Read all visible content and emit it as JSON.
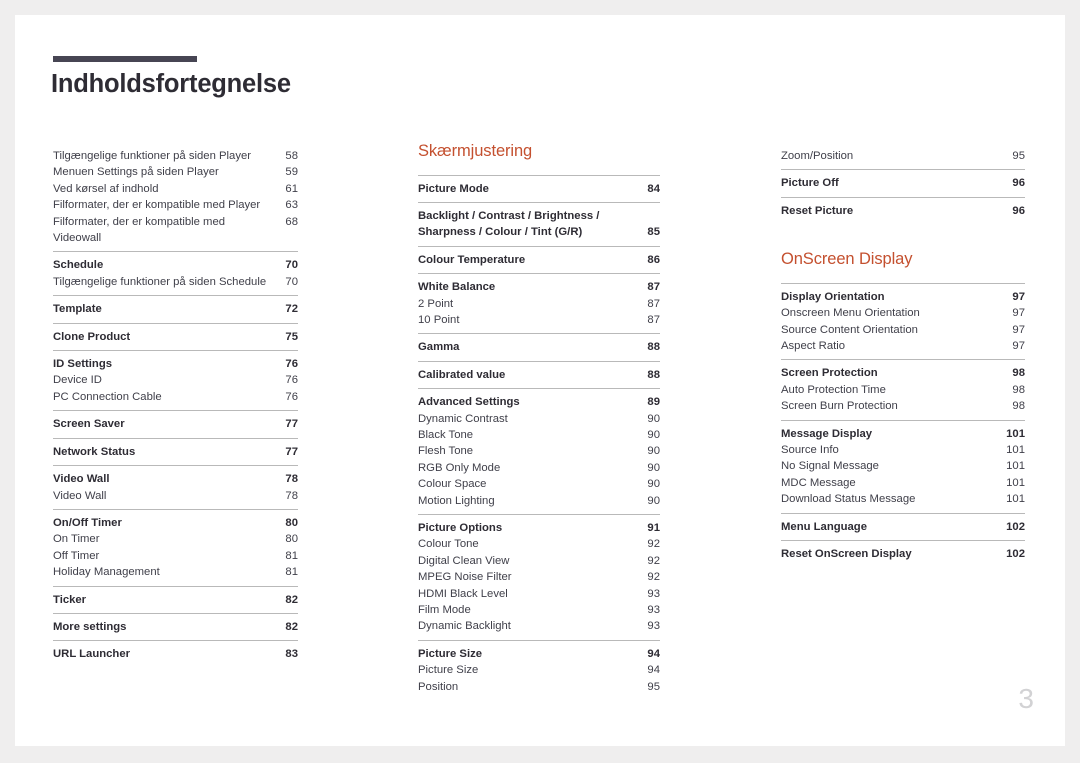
{
  "document": {
    "title": "Indholdsfortegnelse",
    "page_number": "3",
    "accent_color": "#c4502f",
    "rule_color": "#474553"
  },
  "columns": [
    {
      "id": "column-left",
      "heading": null,
      "groups": [
        {
          "rule": false,
          "rows": [
            {
              "level": 2,
              "label": "Tilgængelige funktioner på siden Player",
              "page": "58"
            },
            {
              "level": 2,
              "label": "Menuen Settings på siden Player",
              "page": "59"
            },
            {
              "level": 2,
              "label": "Ved kørsel af indhold",
              "page": "61"
            },
            {
              "level": 2,
              "label": "Filformater, der er kompatible med Player",
              "page": "63"
            },
            {
              "level": 2,
              "label": "Filformater, der er kompatible med Videowall",
              "page": "68"
            }
          ]
        },
        {
          "rule": true,
          "rows": [
            {
              "level": 1,
              "label": "Schedule",
              "page": "70"
            },
            {
              "level": 2,
              "label": "Tilgængelige funktioner på siden Schedule",
              "page": "70"
            }
          ]
        },
        {
          "rule": true,
          "rows": [
            {
              "level": 1,
              "label": "Template",
              "page": "72"
            }
          ]
        },
        {
          "rule": true,
          "rows": [
            {
              "level": 1,
              "label": "Clone Product",
              "page": "75"
            }
          ]
        },
        {
          "rule": true,
          "rows": [
            {
              "level": 1,
              "label": "ID Settings",
              "page": "76"
            },
            {
              "level": 2,
              "label": "Device ID",
              "page": "76"
            },
            {
              "level": 2,
              "label": "PC Connection Cable",
              "page": "76"
            }
          ]
        },
        {
          "rule": true,
          "rows": [
            {
              "level": 1,
              "label": "Screen Saver",
              "page": "77"
            }
          ]
        },
        {
          "rule": true,
          "rows": [
            {
              "level": 1,
              "label": "Network Status",
              "page": "77"
            }
          ]
        },
        {
          "rule": true,
          "rows": [
            {
              "level": 1,
              "label": "Video Wall",
              "page": "78"
            },
            {
              "level": 2,
              "label": "Video Wall",
              "page": "78"
            }
          ]
        },
        {
          "rule": true,
          "rows": [
            {
              "level": 1,
              "label": "On/Off Timer",
              "page": "80"
            },
            {
              "level": 2,
              "label": "On Timer",
              "page": "80"
            },
            {
              "level": 2,
              "label": "Off Timer",
              "page": "81"
            },
            {
              "level": 2,
              "label": "Holiday Management",
              "page": "81"
            }
          ]
        },
        {
          "rule": true,
          "rows": [
            {
              "level": 1,
              "label": "Ticker",
              "page": "82"
            }
          ]
        },
        {
          "rule": true,
          "rows": [
            {
              "level": 1,
              "label": "More settings",
              "page": "82"
            }
          ]
        },
        {
          "rule": true,
          "rows": [
            {
              "level": 1,
              "label": "URL Launcher",
              "page": "83"
            }
          ]
        }
      ]
    },
    {
      "id": "column-middle",
      "heading": "Skærmjustering",
      "groups": [
        {
          "rule": true,
          "rows": [
            {
              "level": 1,
              "label": "Picture Mode",
              "page": "84"
            }
          ]
        },
        {
          "rule": true,
          "rows": [
            {
              "level": 1,
              "label": "Backlight / Contrast / Brightness /\nSharpness / Colour / Tint (G/R)",
              "page": "85",
              "multiline": true
            }
          ]
        },
        {
          "rule": true,
          "rows": [
            {
              "level": 1,
              "label": "Colour Temperature",
              "page": "86"
            }
          ]
        },
        {
          "rule": true,
          "rows": [
            {
              "level": 1,
              "label": "White Balance",
              "page": "87"
            },
            {
              "level": 2,
              "label": "2 Point",
              "page": "87"
            },
            {
              "level": 2,
              "label": "10 Point",
              "page": "87"
            }
          ]
        },
        {
          "rule": true,
          "rows": [
            {
              "level": 1,
              "label": "Gamma",
              "page": "88"
            }
          ]
        },
        {
          "rule": true,
          "rows": [
            {
              "level": 1,
              "label": "Calibrated value",
              "page": "88"
            }
          ]
        },
        {
          "rule": true,
          "rows": [
            {
              "level": 1,
              "label": "Advanced Settings",
              "page": "89"
            },
            {
              "level": 2,
              "label": "Dynamic Contrast",
              "page": "90"
            },
            {
              "level": 2,
              "label": "Black Tone",
              "page": "90"
            },
            {
              "level": 2,
              "label": "Flesh Tone",
              "page": "90"
            },
            {
              "level": 2,
              "label": "RGB Only Mode",
              "page": "90"
            },
            {
              "level": 2,
              "label": "Colour Space",
              "page": "90"
            },
            {
              "level": 2,
              "label": "Motion Lighting",
              "page": "90"
            }
          ]
        },
        {
          "rule": true,
          "rows": [
            {
              "level": 1,
              "label": "Picture Options",
              "page": "91"
            },
            {
              "level": 2,
              "label": "Colour Tone",
              "page": "92"
            },
            {
              "level": 2,
              "label": "Digital Clean View",
              "page": "92"
            },
            {
              "level": 2,
              "label": "MPEG Noise Filter",
              "page": "92"
            },
            {
              "level": 2,
              "label": "HDMI Black Level",
              "page": "93"
            },
            {
              "level": 2,
              "label": "Film Mode",
              "page": "93"
            },
            {
              "level": 2,
              "label": "Dynamic Backlight",
              "page": "93"
            }
          ]
        },
        {
          "rule": true,
          "rows": [
            {
              "level": 1,
              "label": "Picture Size",
              "page": "94"
            },
            {
              "level": 2,
              "label": "Picture Size",
              "page": "94"
            },
            {
              "level": 2,
              "label": "Position",
              "page": "95"
            }
          ]
        }
      ]
    },
    {
      "id": "column-right",
      "heading": null,
      "groups": [
        {
          "rule": false,
          "rows": [
            {
              "level": 2,
              "label": "Zoom/Position",
              "page": "95"
            }
          ]
        },
        {
          "rule": true,
          "rows": [
            {
              "level": 1,
              "label": "Picture Off",
              "page": "96"
            }
          ]
        },
        {
          "rule": true,
          "rows": [
            {
              "level": 1,
              "label": "Reset Picture",
              "page": "96"
            }
          ]
        }
      ],
      "sections": [
        {
          "heading": "OnScreen Display",
          "groups": [
            {
              "rule": true,
              "rows": [
                {
                  "level": 1,
                  "label": "Display Orientation",
                  "page": "97"
                },
                {
                  "level": 2,
                  "label": "Onscreen Menu Orientation",
                  "page": "97"
                },
                {
                  "level": 2,
                  "label": "Source Content Orientation",
                  "page": "97"
                },
                {
                  "level": 2,
                  "label": "Aspect Ratio",
                  "page": "97"
                }
              ]
            },
            {
              "rule": true,
              "rows": [
                {
                  "level": 1,
                  "label": "Screen Protection",
                  "page": "98"
                },
                {
                  "level": 2,
                  "label": "Auto Protection Time",
                  "page": "98"
                },
                {
                  "level": 2,
                  "label": "Screen Burn Protection",
                  "page": "98"
                }
              ]
            },
            {
              "rule": true,
              "rows": [
                {
                  "level": 1,
                  "label": "Message Display",
                  "page": "101"
                },
                {
                  "level": 2,
                  "label": "Source Info",
                  "page": "101"
                },
                {
                  "level": 2,
                  "label": "No Signal Message",
                  "page": "101"
                },
                {
                  "level": 2,
                  "label": "MDC Message",
                  "page": "101"
                },
                {
                  "level": 2,
                  "label": "Download Status Message",
                  "page": "101"
                }
              ]
            },
            {
              "rule": true,
              "rows": [
                {
                  "level": 1,
                  "label": "Menu Language",
                  "page": "102"
                }
              ]
            },
            {
              "rule": true,
              "rows": [
                {
                  "level": 1,
                  "label": "Reset OnScreen Display",
                  "page": "102"
                }
              ]
            }
          ]
        }
      ]
    }
  ]
}
